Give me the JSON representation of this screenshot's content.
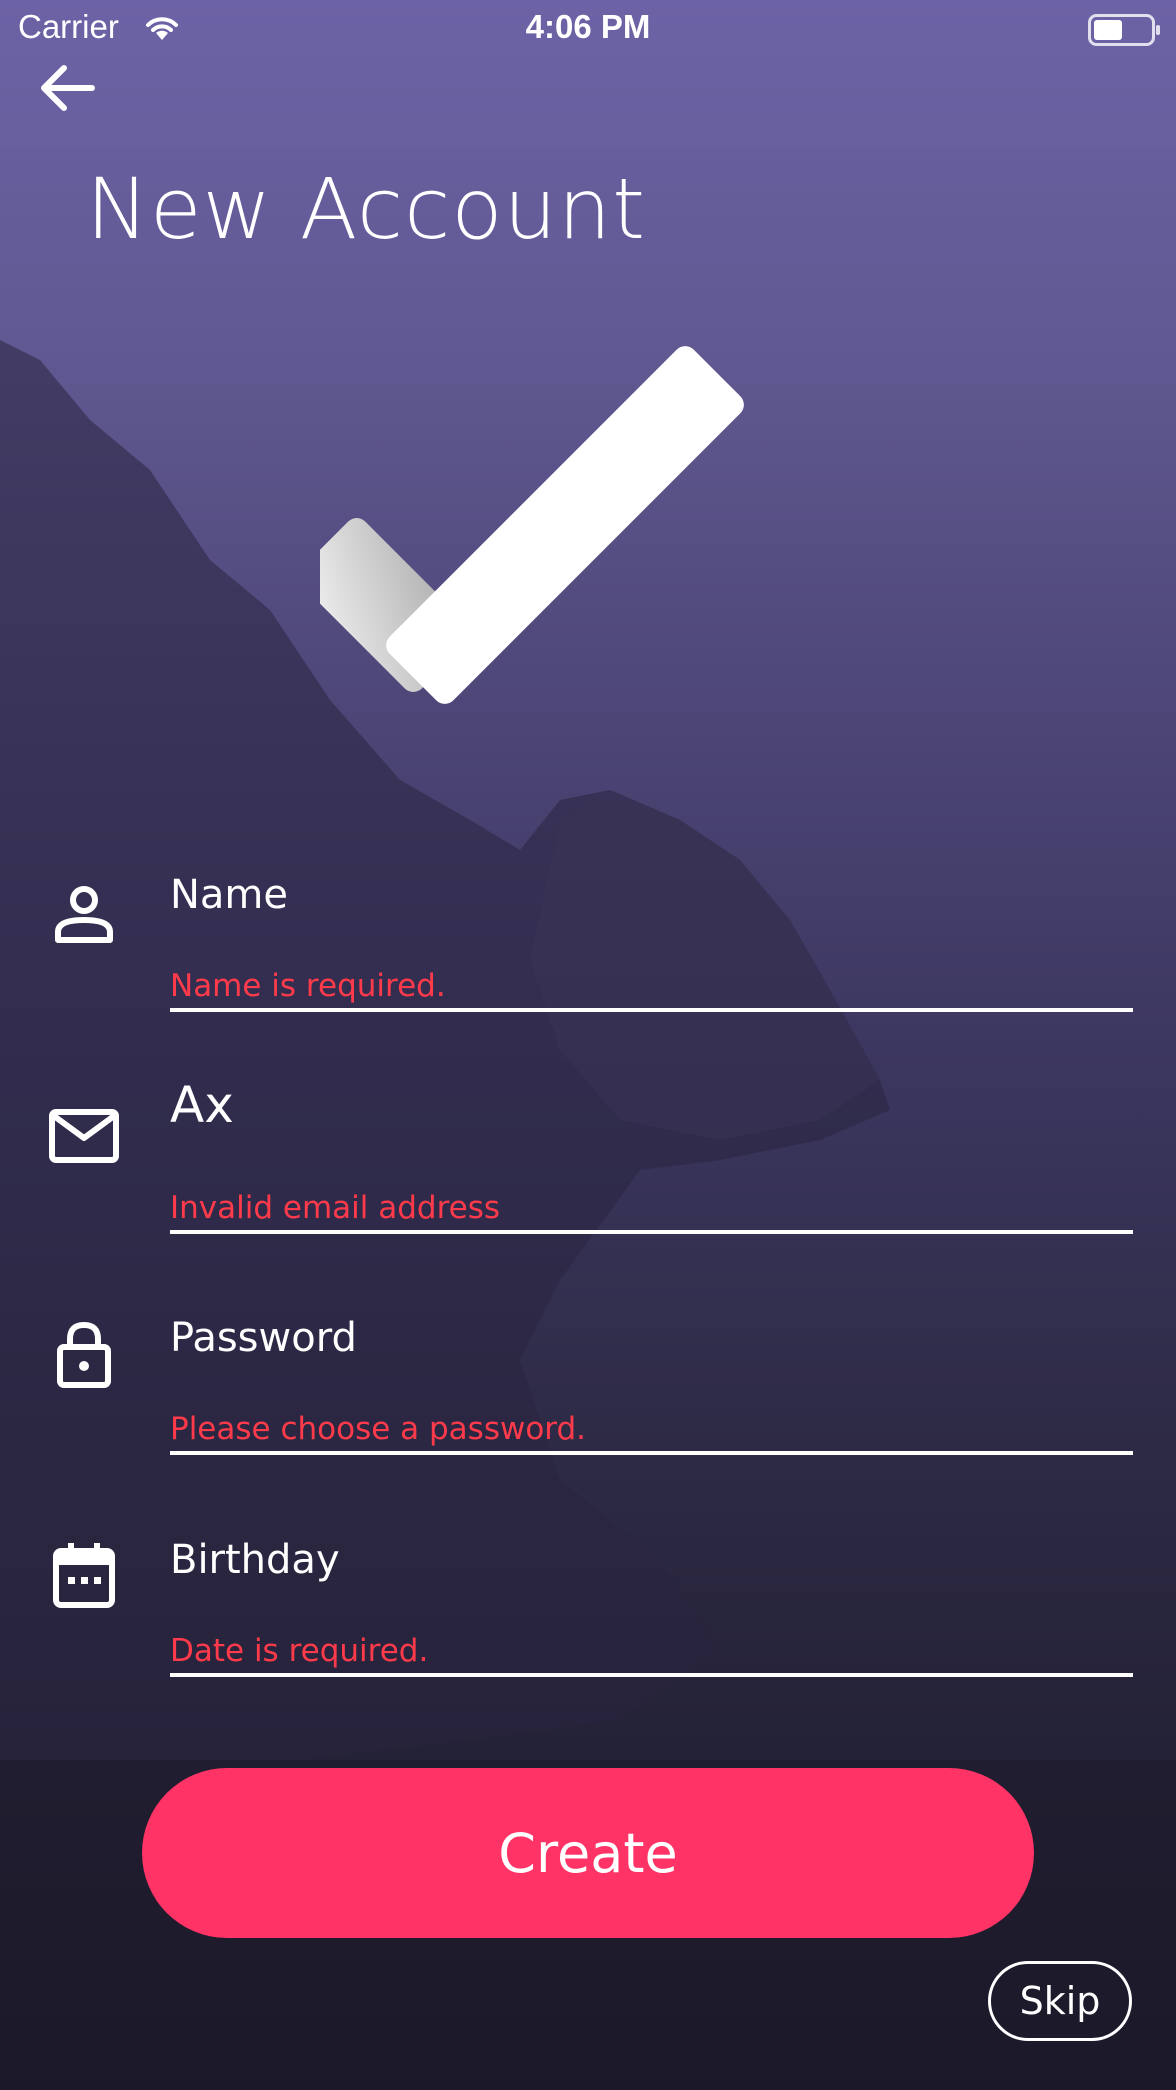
{
  "status_bar": {
    "carrier": "Carrier",
    "time": "4:06 PM"
  },
  "header": {
    "title": "New Account"
  },
  "form": {
    "name": {
      "placeholder": "Name",
      "value": "",
      "error": "Name is required.",
      "icon": "person-icon"
    },
    "email": {
      "placeholder": "",
      "value": "Ax",
      "error": "Invalid email address",
      "icon": "mail-icon"
    },
    "password": {
      "placeholder": "Password",
      "value": "",
      "error": "Please choose a password.",
      "icon": "lock-icon"
    },
    "birthday": {
      "placeholder": "Birthday",
      "value": "",
      "error": "Date is required.",
      "icon": "calendar-icon"
    }
  },
  "actions": {
    "create_label": "Create",
    "skip_label": "Skip"
  },
  "colors": {
    "accent": "#ff3366",
    "error": "#ff3a4a",
    "background_top": "#6c63a6",
    "background_bottom": "#1d1b2b"
  }
}
